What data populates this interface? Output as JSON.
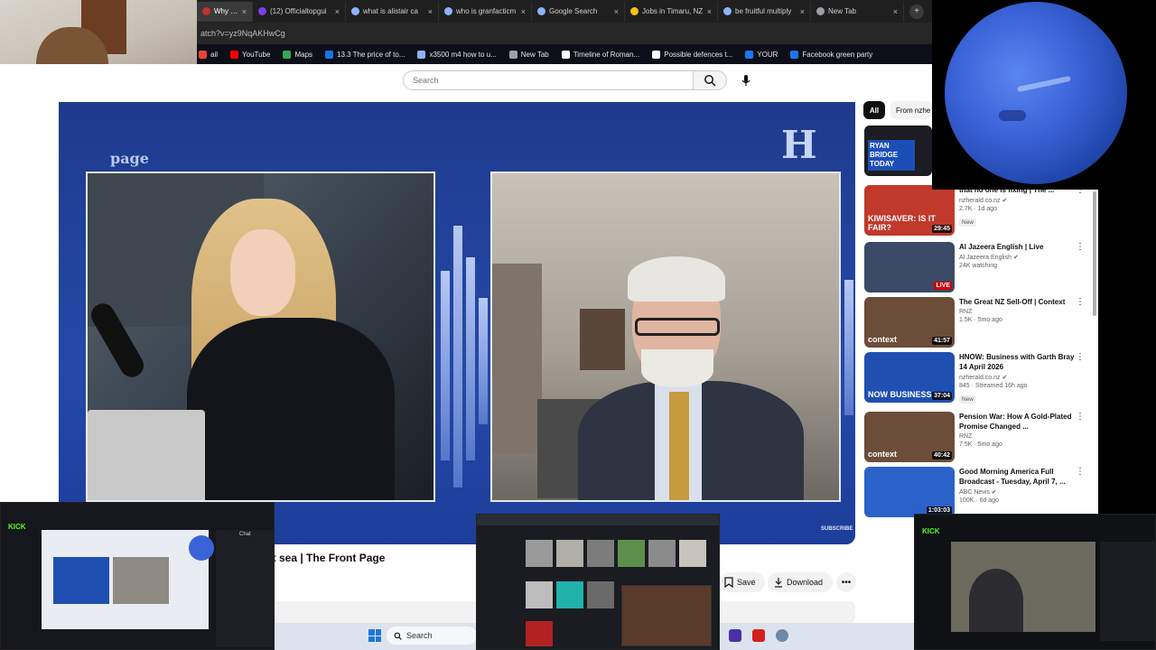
{
  "browser": {
    "tabs": [
      {
        "label": "Why Tru",
        "active": true,
        "color": "#c4302b"
      },
      {
        "label": "(12) Officialtopgui",
        "active": false,
        "color": "#7b3fe4"
      },
      {
        "label": "what is alistair ca",
        "active": false,
        "color": "#8ab4f8"
      },
      {
        "label": "who is granfacticm",
        "active": false,
        "color": "#8ab4f8"
      },
      {
        "label": "Google Search",
        "active": false,
        "color": "#8ab4f8"
      },
      {
        "label": "Jobs in Timaru, NZ",
        "active": false,
        "color": "#f4c20d"
      },
      {
        "label": "be fruitful multiply",
        "active": false,
        "color": "#8ab4f8"
      },
      {
        "label": "New Tab",
        "active": false,
        "color": "#9aa0a6"
      }
    ],
    "new_tab_symbol": "+",
    "address": "atch?v=yz9NqAKHwCg",
    "bookmarks": [
      {
        "label": "ail",
        "color": "#ea4335"
      },
      {
        "label": "YouTube",
        "color": "#ff0000"
      },
      {
        "label": "Maps",
        "color": "#34a853"
      },
      {
        "label": "13.3 The price of to...",
        "color": "#1a73e8"
      },
      {
        "label": "x3500 m4 how to u...",
        "color": "#8ab4f8"
      },
      {
        "label": "New Tab",
        "color": "#9aa0a6"
      },
      {
        "label": "Timeline of Roman...",
        "color": "#ffffff"
      },
      {
        "label": "Possible defences t...",
        "color": "#ffffff"
      },
      {
        "label": "YOUR",
        "color": "#1877f2"
      },
      {
        "label": "Facebook green party",
        "color": "#1877f2"
      }
    ]
  },
  "youtube": {
    "search_placeholder": "Search",
    "player": {
      "show_logo": "page",
      "brand_mark": "H",
      "subscribe_tag": "SUBSCRIBE"
    },
    "video_title": "at sea | The Front Page",
    "actions": {
      "save": "Save",
      "download": "Download",
      "more": "•••"
    },
    "chips": {
      "all": "All",
      "from": "From nzhe"
    },
    "recommendations": [
      {
        "title": "that no one is fixing | The ...",
        "channel": "nzherald.co.nz",
        "verified": true,
        "meta": "2.7K · 1d ago",
        "badge": "New",
        "duration": "29:45",
        "thumb": "#c0392b",
        "thumb_text": "KIWISAVER: IS IT FAIR?"
      },
      {
        "title": "Al Jazeera English | Live",
        "channel": "Al Jazeera English",
        "verified": true,
        "meta": "24K watching",
        "badge": "",
        "duration": "LIVE",
        "thumb": "#3b4a66",
        "thumb_text": ""
      },
      {
        "title": "The Great NZ Sell-Off | Context",
        "channel": "RNZ",
        "verified": false,
        "meta": "1.5K · 5mo ago",
        "badge": "",
        "duration": "41:57",
        "thumb": "#6b4d3a",
        "thumb_text": "context"
      },
      {
        "title": "HNOW: Business with Garth Bray 14 April 2026",
        "channel": "nzherald.co.nz",
        "verified": true,
        "meta": "845 · Streamed 16h ago",
        "badge": "New",
        "duration": "37:04",
        "thumb": "#1f4fb0",
        "thumb_text": "NOW BUSINESS"
      },
      {
        "title": "Pension War: How A Gold-Plated Promise Changed ...",
        "channel": "RNZ",
        "verified": false,
        "meta": "7.5K · 5mo ago",
        "badge": "",
        "duration": "40:42",
        "thumb": "#6b4d3a",
        "thumb_text": "context"
      },
      {
        "title": "Good Morning America Full Broadcast - Tuesday, April 7, ...",
        "channel": "ABC News",
        "verified": true,
        "meta": "100K · 6d ago",
        "badge": "",
        "duration": "1:03:03",
        "thumb": "#2b62c9",
        "thumb_text": ""
      }
    ],
    "top_thumb_text": "RYAN BRIDGE TODAY"
  },
  "taskbar": {
    "search_label": "Search"
  },
  "overlays": {
    "kick_label": "KICK",
    "chat_label": "Chat"
  }
}
